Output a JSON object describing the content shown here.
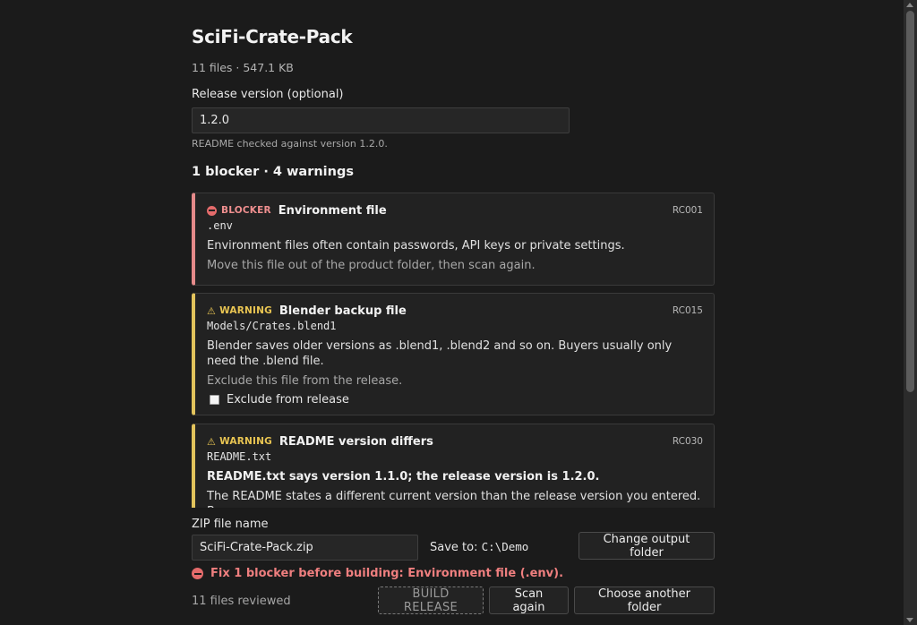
{
  "project": {
    "title": "SciFi-Crate-Pack",
    "meta": "11 files · 547.1 KB"
  },
  "release": {
    "label": "Release version (optional)",
    "value": "1.2.0",
    "note": "README checked against version 1.2.0."
  },
  "summary": "1 blocker · 4 warnings",
  "issues": [
    {
      "severity": "BLOCKER",
      "title": "Environment file",
      "code": "RC001",
      "path": ".env",
      "description": "Environment files often contain passwords, API keys or private settings.",
      "fix": "Move this file out of the product folder, then scan again."
    },
    {
      "severity": "WARNING",
      "title": "Blender backup file",
      "code": "RC015",
      "path": "Models/Crates.blend1",
      "description": "Blender saves older versions as .blend1, .blend2 and so on. Buyers usually only need the .blend file.",
      "fix": "Exclude this file from the release.",
      "checkbox_label": "Exclude from release"
    },
    {
      "severity": "WARNING",
      "title": "README version differs",
      "code": "RC030",
      "path": "README.txt",
      "headline": "README.txt says version 1.1.0; the release version is 1.2.0.",
      "description": "The README states a different current version than the release version you entered. Buyers may"
    }
  ],
  "output": {
    "zip_label": "ZIP file name",
    "zip_value": "SciFi-Crate-Pack.zip",
    "save_to_label": "Save to:",
    "save_to_path": "C:\\Demo",
    "change_folder_label": "Change output folder"
  },
  "error_message": "Fix 1 blocker before building: Environment file (.env).",
  "footer": {
    "reviewed": "11 files reviewed",
    "build_label": "BUILD RELEASE",
    "scan_label": "Scan again",
    "choose_label": "Choose another folder"
  },
  "colors": {
    "background": "#1b1b1b",
    "blocker": "#e58a8a",
    "warning": "#e2c35c"
  }
}
